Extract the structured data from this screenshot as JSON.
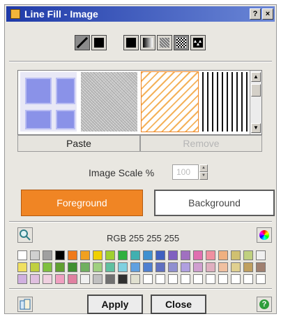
{
  "window": {
    "title": "Line Fill - Image"
  },
  "titlebar": {
    "help_label": "?",
    "close_label": "×"
  },
  "toolbar": {
    "mode_icons": [
      "line-fill-icon",
      "solid-fill-icon"
    ],
    "fill_type_icons": [
      "solid-pattern-icon",
      "gradient-pattern-icon",
      "texture-pattern-icon",
      "checker-pattern-icon",
      "image-pattern-icon"
    ]
  },
  "gallery": {
    "thumbnails": [
      "blue-tiles-thumbnail",
      "gray-noise-thumbnail",
      "orange-diagonal-thumbnail",
      "black-stripes-thumbnail"
    ],
    "selected": "orange-diagonal-thumbnail"
  },
  "buttons": {
    "paste": "Paste",
    "remove": "Remove"
  },
  "scale": {
    "label": "Image Scale %",
    "value": "100"
  },
  "colors": {
    "foreground_label": "Foreground",
    "background_label": "Background",
    "foreground_color": "#F08524",
    "background_color": "#FFFFFF"
  },
  "rgb": {
    "text": "RGB 255 255 255"
  },
  "palette": {
    "rows": [
      [
        "#FFFFFF",
        "#D0D0D0",
        "#A0A0A0",
        "#000000",
        "#F07A1A",
        "#F0A020",
        "#F0D000",
        "#A0D030",
        "#30B040",
        "#40B0B0",
        "#4090D0",
        "#4060C0",
        "#8060C0",
        "#A070C0",
        "#E070B0",
        "#F090A0",
        "#F0B080",
        "#D0C070",
        "#C0D080",
        "#F0F0F0"
      ],
      [
        "#F0E060",
        "#C0D040",
        "#80C040",
        "#60A030",
        "#409030",
        "#70B060",
        "#A0D080",
        "#60C0A0",
        "#80D0E0",
        "#60A0E0",
        "#5080D0",
        "#6070C0",
        "#9090D0",
        "#B0A0E0",
        "#D0A0D0",
        "#E0B0C0",
        "#F0C0A0",
        "#E0D090",
        "#C0A060",
        "#A08070"
      ],
      [
        "#D0B0E0",
        "#E0C0E0",
        "#F0D0E0",
        "#F0A0C0",
        "#E080A0",
        "#F0F0F0",
        "#C0C0C0",
        "#707070",
        "#303030",
        "#E0E0D0",
        "#FFFFFF",
        "#FFFFFF",
        "#FFFFFF",
        "#FFFFFF",
        "#FFFFFF",
        "#FFFFFF",
        "#FFFFFF",
        "#FFFFFF",
        "#FFFFFF",
        "#FFFFFF"
      ]
    ]
  },
  "footer": {
    "apply_label": "Apply",
    "close_label": "Close"
  }
}
